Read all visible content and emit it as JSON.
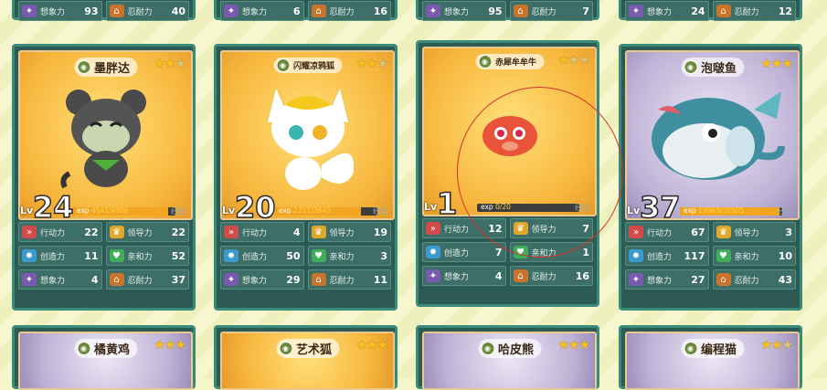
{
  "top_row": [
    {
      "a_label": "想象力",
      "a_value": "93",
      "b_label": "忍耐力",
      "b_value": "40"
    },
    {
      "a_label": "想象力",
      "a_value": "6",
      "b_label": "忍耐力",
      "b_value": "16"
    },
    {
      "a_label": "想象力",
      "a_value": "95",
      "b_label": "忍耐力",
      "b_value": "7"
    },
    {
      "a_label": "想象力",
      "a_value": "24",
      "b_label": "忍耐力",
      "b_value": "12"
    }
  ],
  "cards": [
    {
      "name": "墨胖达",
      "stars_filled": 2,
      "stars_total": 3,
      "level": "24",
      "exp_label": "exp",
      "exp_text": "4541/4906",
      "exp_pct": 0.93,
      "exp_end": "经验",
      "stats": [
        {
          "label": "行动力",
          "value": "22",
          "icon": "run-icon"
        },
        {
          "label": "领导力",
          "value": "22",
          "icon": "crown-icon"
        },
        {
          "label": "创造力",
          "value": "11",
          "icon": "gear-icon"
        },
        {
          "label": "亲和力",
          "value": "52",
          "icon": "heart-icon"
        },
        {
          "label": "想象力",
          "value": "4",
          "icon": "brain-icon"
        },
        {
          "label": "忍耐力",
          "value": "37",
          "icon": "shield-icon"
        }
      ]
    },
    {
      "name": "闪耀凉鸦狐",
      "stars_filled": 2,
      "stars_total": 3,
      "level": "20",
      "exp_label": "exp",
      "exp_text": "2211/2640",
      "exp_pct": 0.84,
      "exp_end": "经验",
      "stats": [
        {
          "label": "行动力",
          "value": "4",
          "icon": "run-icon"
        },
        {
          "label": "领导力",
          "value": "19",
          "icon": "crown-icon"
        },
        {
          "label": "创造力",
          "value": "50",
          "icon": "gear-icon"
        },
        {
          "label": "亲和力",
          "value": "3",
          "icon": "heart-icon"
        },
        {
          "label": "想象力",
          "value": "29",
          "icon": "brain-icon"
        },
        {
          "label": "忍耐力",
          "value": "11",
          "icon": "shield-icon"
        }
      ]
    },
    {
      "name": "赤犀牟牟牛",
      "stars_filled": 1,
      "stars_total": 3,
      "level": "1",
      "exp_label": "exp",
      "exp_text": "0/20",
      "exp_pct": 0.0,
      "exp_end": "经验",
      "stats": [
        {
          "label": "行动力",
          "value": "12",
          "icon": "run-icon"
        },
        {
          "label": "领导力",
          "value": "7",
          "icon": "crown-icon"
        },
        {
          "label": "创造力",
          "value": "7",
          "icon": "gear-icon"
        },
        {
          "label": "亲和力",
          "value": "1",
          "icon": "heart-icon"
        },
        {
          "label": "想象力",
          "value": "4",
          "icon": "brain-icon"
        },
        {
          "label": "忍耐力",
          "value": "16",
          "icon": "shield-icon"
        }
      ]
    },
    {
      "name": "泡啵鱼",
      "stars_filled": 3,
      "stars_total": 3,
      "level": "37",
      "exp_label": "exp",
      "exp_text": "19963/20505",
      "exp_pct": 0.97,
      "exp_end": "经验",
      "stats": [
        {
          "label": "行动力",
          "value": "67",
          "icon": "run-icon"
        },
        {
          "label": "领导力",
          "value": "3",
          "icon": "crown-icon"
        },
        {
          "label": "创造力",
          "value": "117",
          "icon": "gear-icon"
        },
        {
          "label": "亲和力",
          "value": "10",
          "icon": "heart-icon"
        },
        {
          "label": "想象力",
          "value": "27",
          "icon": "brain-icon"
        },
        {
          "label": "忍耐力",
          "value": "43",
          "icon": "shield-icon"
        }
      ]
    }
  ],
  "bottom_row": [
    {
      "name": "橘黄鸡",
      "stars_filled": 3
    },
    {
      "name": "艺术狐",
      "stars_filled": 3
    },
    {
      "name": "哈皮熊",
      "stars_filled": 3
    },
    {
      "name": "编程猫",
      "stars_filled": 2
    }
  ],
  "lv_label": "Lv",
  "colors": {
    "card_bg": "#2e5a55",
    "card_border": "#3a8a79",
    "gold": "#f7b63c",
    "star": "#f7c21b",
    "annotation": "#d4322c"
  }
}
